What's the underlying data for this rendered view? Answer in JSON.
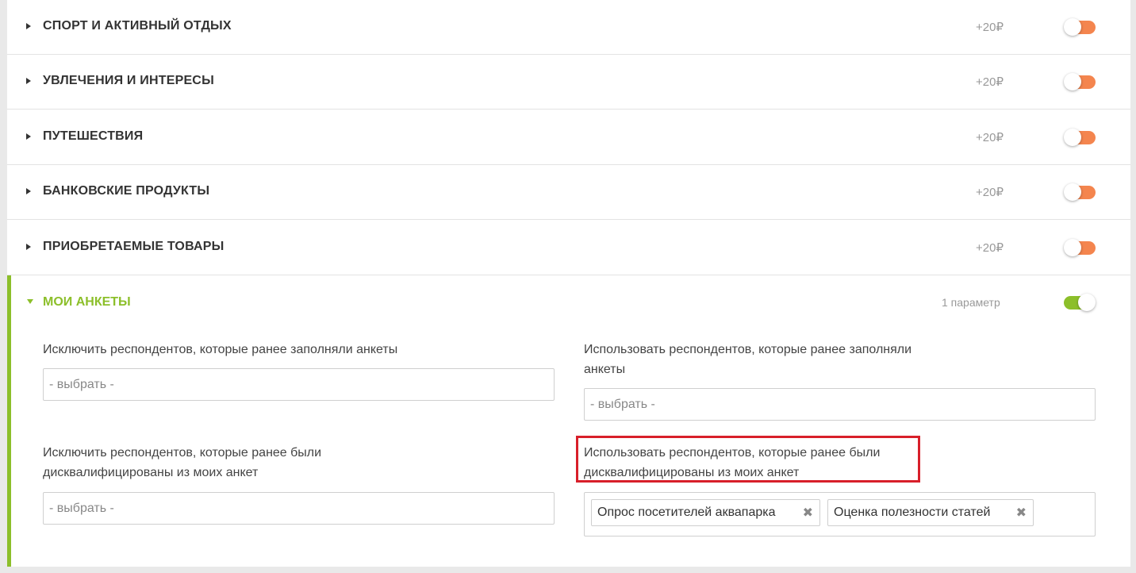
{
  "colors": {
    "accent_green": "#8cbf2a",
    "toggle_off_orange": "#f4854e",
    "highlight_red": "#d81f2a"
  },
  "sections": [
    {
      "title": "СПОРТ И АКТИВНЫЙ ОТДЫХ",
      "price": "+20₽",
      "toggle": "off"
    },
    {
      "title": "УВЛЕЧЕНИЯ И ИНТЕРЕСЫ",
      "price": "+20₽",
      "toggle": "off"
    },
    {
      "title": "ПУТЕШЕСТВИЯ",
      "price": "+20₽",
      "toggle": "off"
    },
    {
      "title": "БАНКОВСКИЕ ПРОДУКТЫ",
      "price": "+20₽",
      "toggle": "off"
    },
    {
      "title": "ПРИОБРЕТАЕМЫЕ ТОВАРЫ",
      "price": "+20₽",
      "toggle": "off"
    }
  ],
  "my_surveys": {
    "title": "МОИ АНКЕТЫ",
    "params": "1 параметр",
    "toggle": "on",
    "exclude_filled": {
      "label": "Исключить респондентов, которые ранее заполняли анкеты",
      "placeholder": "- выбрать -"
    },
    "use_filled": {
      "label_line1": "Использовать респондентов, которые ранее заполняли",
      "label_line2": "анкеты",
      "placeholder": "- выбрать -"
    },
    "exclude_disqualified": {
      "label_line1": "Исключить респондентов, которые ранее были",
      "label_line2": "дисквалифицированы из моих анкет",
      "placeholder": "- выбрать -"
    },
    "use_disqualified": {
      "label_line1": "Использовать респондентов, которые ранее были",
      "label_line2": "дисквалифицированы из моих анкет",
      "tags": [
        {
          "text": "Опрос посетителей аквапарка",
          "remove": "✖"
        },
        {
          "text": "Оценка полезности статей",
          "remove": "✖"
        }
      ]
    }
  }
}
